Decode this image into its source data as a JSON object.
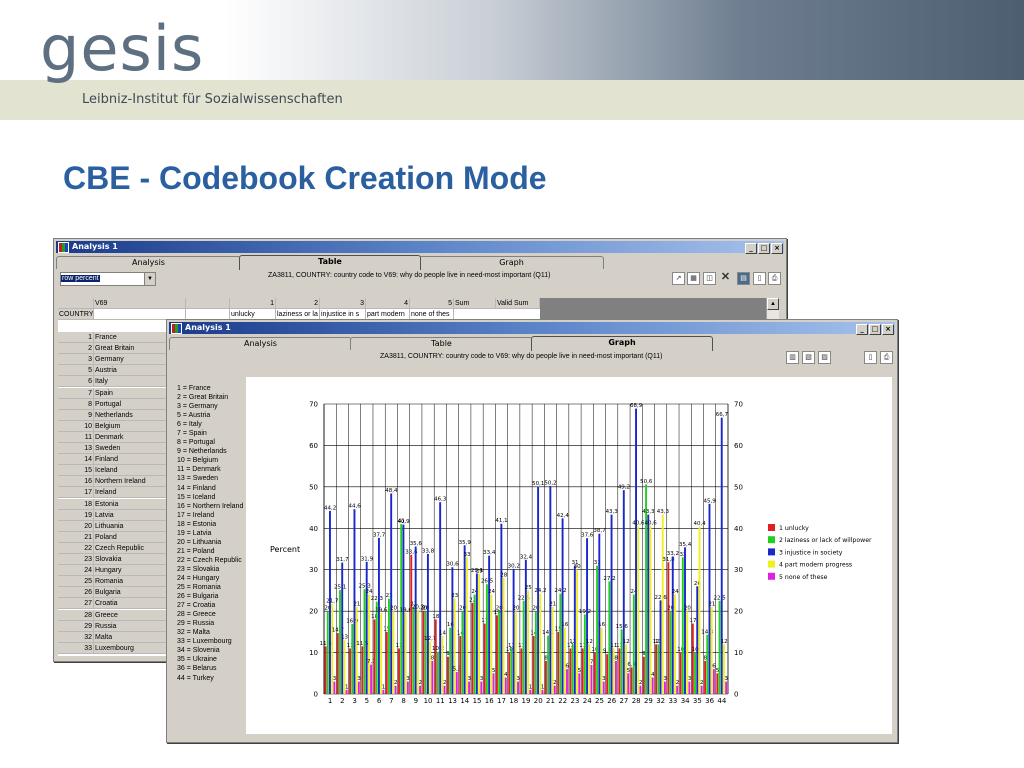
{
  "header": {
    "logo": "gesis",
    "logo_subtitle": "Leibniz-Institut für Sozialwissenschaften"
  },
  "slide_title": "CBE - Codebook Creation Mode",
  "back_window": {
    "title": "Analysis 1",
    "tabs": [
      "Analysis",
      "Table",
      "Graph"
    ],
    "active_tab": "Table",
    "caption": "ZA3811, COUNTRY: country code to V69: why do people live in need-most important (Q11)",
    "combo_value": "row percent",
    "table": {
      "header_row1": [
        "V69",
        "",
        "1",
        "2",
        "3",
        "4",
        "5",
        "Sum",
        "Valid Sum"
      ],
      "header_row2": [
        "COUNTRY",
        "",
        "",
        "unlucky",
        "laziness or la",
        "injustice in s",
        "part modern",
        "none of thes"
      ],
      "rows": [
        [
          "1",
          "France"
        ],
        [
          "2",
          "Great Britain"
        ],
        [
          "3",
          "Germany"
        ],
        [
          "5",
          "Austria"
        ],
        [
          "6",
          "Italy"
        ],
        [
          "7",
          "Spain"
        ],
        [
          "8",
          "Portugal"
        ],
        [
          "9",
          "Netherlands"
        ],
        [
          "10",
          "Belgium"
        ],
        [
          "11",
          "Denmark"
        ],
        [
          "13",
          "Sweden"
        ],
        [
          "14",
          "Finland"
        ],
        [
          "15",
          "Iceland"
        ],
        [
          "16",
          "Northern Ireland"
        ],
        [
          "17",
          "Ireland"
        ],
        [
          "18",
          "Estonia"
        ],
        [
          "19",
          "Latvia"
        ],
        [
          "20",
          "Lithuania"
        ],
        [
          "21",
          "Poland"
        ],
        [
          "22",
          "Czech Republic"
        ],
        [
          "23",
          "Slovakia"
        ],
        [
          "24",
          "Hungary"
        ],
        [
          "25",
          "Romania"
        ],
        [
          "26",
          "Bulgaria"
        ],
        [
          "27",
          "Croatia"
        ],
        [
          "28",
          "Greece"
        ],
        [
          "29",
          "Russia"
        ],
        [
          "32",
          "Malta"
        ],
        [
          "33",
          "Luxembourg"
        ]
      ]
    }
  },
  "front_window": {
    "title": "Analysis 1",
    "tabs": [
      "Analysis",
      "Table",
      "Graph"
    ],
    "active_tab": "Graph",
    "caption": "ZA3811, COUNTRY: country code to V69: why do people live in need-most important (Q11)",
    "country_key": [
      "1 = France",
      "2 = Great Britain",
      "3 = Germany",
      "5 = Austria",
      "6 = Italy",
      "7 = Spain",
      "8 = Portugal",
      "9 = Netherlands",
      "10 = Belgium",
      "11 = Denmark",
      "13 = Sweden",
      "14 = Finland",
      "15 = Iceland",
      "16 = Northern Ireland",
      "17 = Ireland",
      "18 = Estonia",
      "19 = Latvia",
      "20 = Lithuania",
      "21 = Poland",
      "22 = Czech Republic",
      "23 = Slovakia",
      "24 = Hungary",
      "25 = Romania",
      "26 = Bulgaria",
      "27 = Croatia",
      "28 = Greece",
      "29 = Russia",
      "32 = Malta",
      "33 = Luxembourg",
      "34 = Slovenia",
      "35 = Ukraine",
      "36 = Belarus",
      "44 = Turkey"
    ]
  },
  "chart_data": {
    "type": "bar",
    "title": "",
    "xlabel": "",
    "ylabel": "Percent",
    "ylim": [
      0,
      70
    ],
    "yticks": [
      0,
      10,
      20,
      30,
      40,
      50,
      60,
      70
    ],
    "grid": true,
    "legend_position": "right",
    "categories": [
      "1",
      "2",
      "3",
      "5",
      "6",
      "7",
      "8",
      "9",
      "10",
      "11",
      "13",
      "14",
      "15",
      "16",
      "17",
      "18",
      "19",
      "20",
      "21",
      "22",
      "23",
      "24",
      "25",
      "26",
      "27",
      "28",
      "29",
      "32",
      "33",
      "34",
      "35",
      "36",
      "44"
    ],
    "series": [
      {
        "name": "1 unlucky",
        "color": "#e02020",
        "values": [
          11.5,
          14.7,
          11.0,
          11.5,
          18.0,
          15.0,
          11.0,
          33.6,
          20.0,
          18.0,
          9.0,
          14.0,
          22.0,
          17.0,
          19.0,
          10.0,
          11.0,
          14.0,
          8.0,
          15.0,
          11.0,
          11.0,
          10.0,
          9.6,
          11.0,
          6.4,
          9.0,
          12.0,
          31.8,
          10.0,
          17.0,
          8.0,
          5.0
        ]
      },
      {
        "name": "2 laziness or lack of willpower",
        "color": "#20d020",
        "values": [
          20.0,
          25.1,
          16.9,
          25.3,
          22.3,
          23.0,
          41.0,
          21.0,
          20.0,
          10.2,
          16.0,
          20.0,
          24.0,
          26.5,
          20.0,
          11.0,
          22.5,
          20.0,
          14.1,
          24.2,
          12.0,
          19.2,
          31.0,
          27.2,
          15.6,
          24.0,
          50.6,
          12.0,
          20.0,
          33.0,
          10.0,
          14.3,
          22.5
        ]
      },
      {
        "name": "3 injustice in society",
        "color": "#1a28c8",
        "values": [
          44.2,
          31.7,
          44.6,
          31.9,
          37.7,
          48.4,
          40.9,
          35.6,
          33.8,
          46.3,
          30.6,
          35.9,
          29.1,
          33.4,
          41.1,
          30.2,
          32.4,
          50.1,
          50.2,
          42.4,
          31.0,
          37.6,
          38.7,
          43.3,
          49.2,
          68.9,
          43.3,
          22.6,
          33.2,
          35.4,
          26.0,
          45.9,
          66.7
        ]
      },
      {
        "name": "4 part modern progress",
        "color": "#f0f020",
        "values": [
          21.7,
          13.0,
          21.0,
          24.0,
          19.6,
          20.0,
          19.6,
          20.3,
          12.7,
          14.0,
          23.0,
          33.0,
          29.0,
          24.0,
          28.0,
          20.0,
          25.0,
          24.2,
          21.0,
          16.0,
          30.0,
          12.0,
          16.0,
          11.0,
          12.0,
          40.6,
          40.6,
          43.3,
          24.0,
          20.0,
          40.4,
          21.0,
          12.0
        ]
      },
      {
        "name": "5 none of these",
        "color": "#e020e0",
        "values": [
          3.0,
          1.0,
          3.0,
          7.1,
          1.0,
          2.0,
          3.0,
          2.0,
          8.0,
          2.0,
          5.3,
          3.0,
          3.0,
          5.0,
          4.0,
          3.0,
          1.0,
          1.0,
          2.0,
          6.0,
          5.0,
          7.0,
          3.0,
          8.0,
          5.0,
          2.0,
          4.0,
          3.0,
          2.0,
          3.0,
          2.0,
          6.0,
          3.0
        ]
      }
    ]
  }
}
